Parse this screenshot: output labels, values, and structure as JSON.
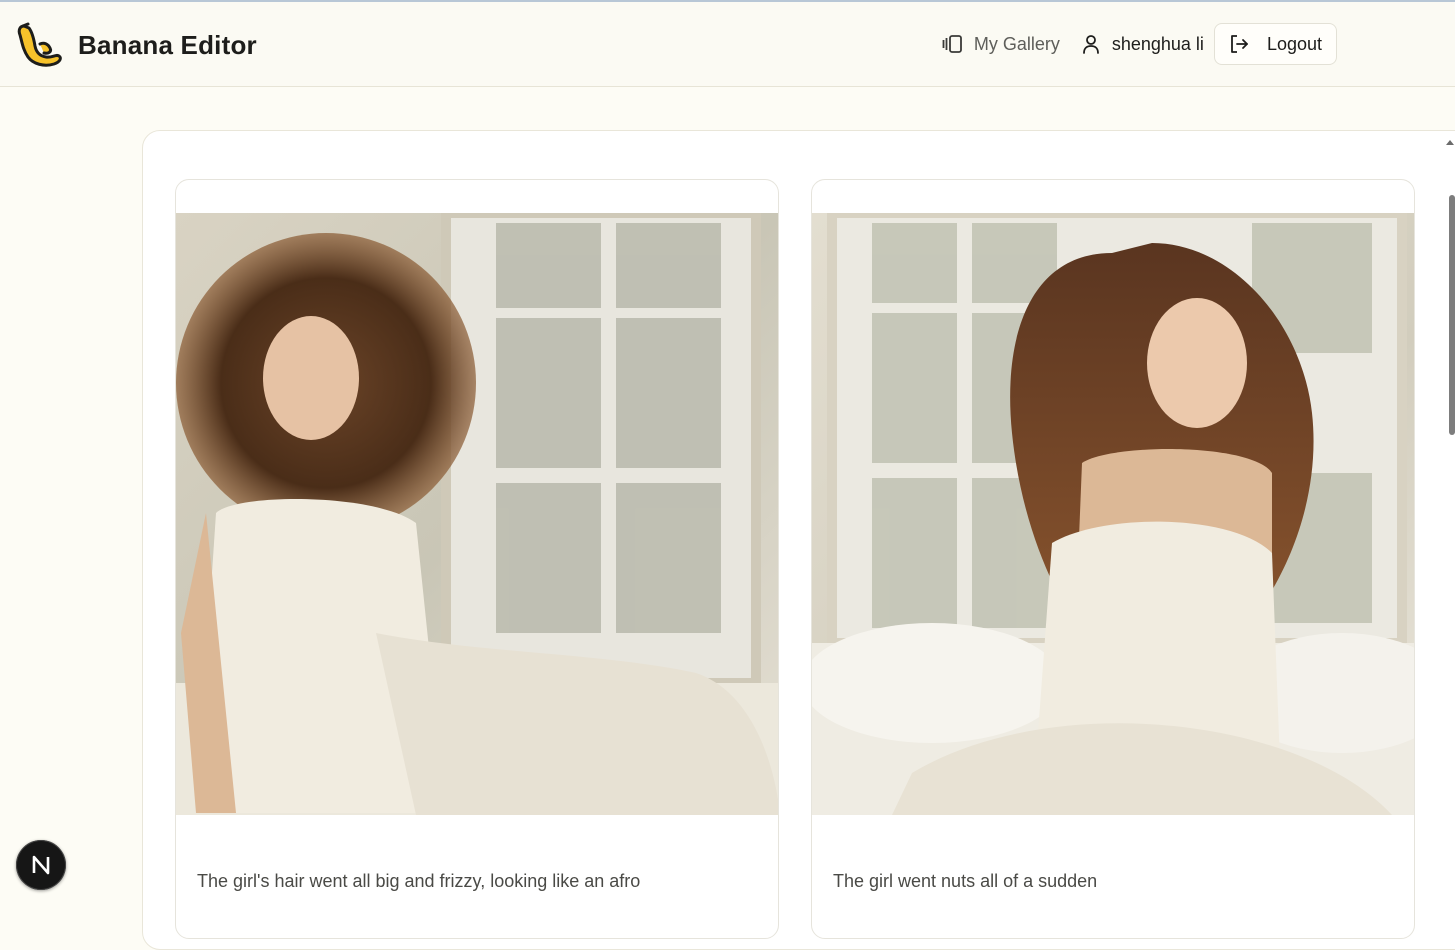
{
  "app": {
    "name": "Banana Editor",
    "logo_icon": "banana-logo-icon"
  },
  "nav": {
    "gallery_label": "My Gallery",
    "gallery_icon": "gallery-icon",
    "user_name": "shenghua li",
    "user_icon": "user-icon",
    "logout_label": "Logout",
    "logout_icon": "logout-icon"
  },
  "gallery": {
    "cards": [
      {
        "caption": "The girl's hair went all big and frizzy, looking like an afro"
      },
      {
        "caption": "The girl went nuts all of a sudden"
      }
    ]
  },
  "dev_badge": {
    "letter": "N"
  },
  "colors": {
    "page_bg": "#fdfcf5",
    "brand_yellow": "#f6c22b",
    "text": "#1d1d1b"
  }
}
